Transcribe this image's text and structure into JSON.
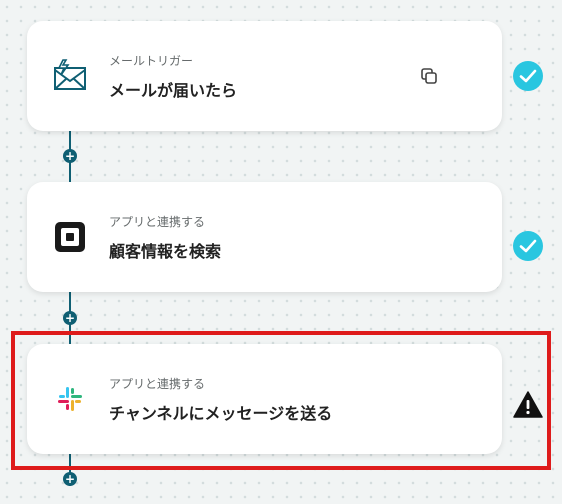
{
  "steps": [
    {
      "category": "メールトリガー",
      "title": "メールが届いたら",
      "icon": "mail-icon",
      "status": "complete"
    },
    {
      "category": "アプリと連携する",
      "title": "顧客情報を検索",
      "icon": "square-icon",
      "status": "complete"
    },
    {
      "category": "アプリと連携する",
      "title": "チャンネルにメッセージを送る",
      "icon": "slack-icon",
      "status": "warning"
    }
  ],
  "add_button_label": "+",
  "colors": {
    "connector": "#0f5f73",
    "check": "#29c6e0",
    "highlight": "#de1b1b",
    "warning": "#111111"
  }
}
